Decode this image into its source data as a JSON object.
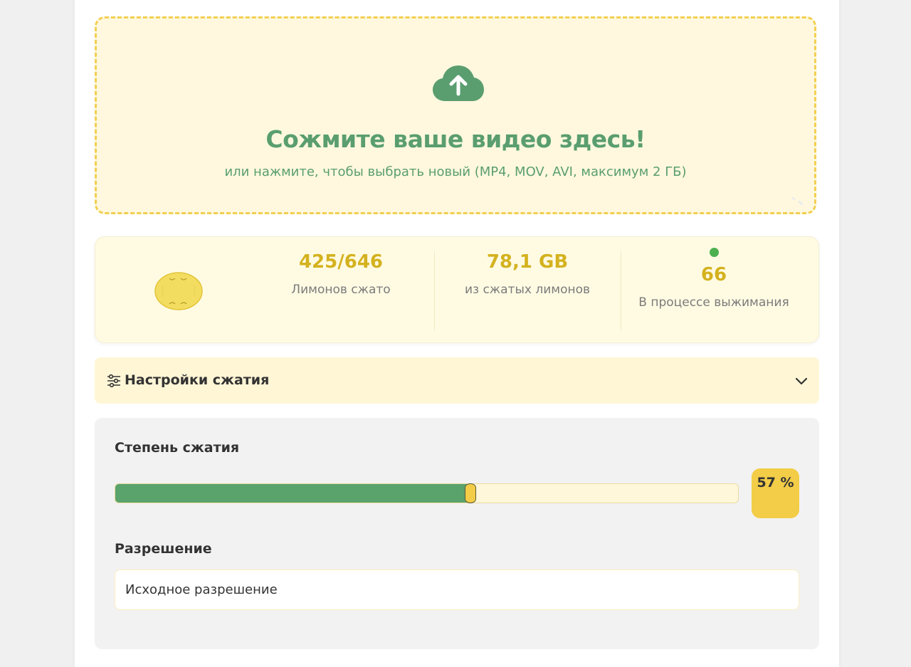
{
  "upload": {
    "icon": "cloud-upload-icon",
    "title": "Сожмите ваше видео здесь!",
    "subtitle": "или нажмите, чтобы выбрать новый (MP4, MOV, AVI, максимум 2 ГБ)"
  },
  "stats": {
    "compressed": {
      "value": "425/646",
      "label": "Лимонов сжато"
    },
    "size": {
      "value": "78,1 GB",
      "label": "из сжатых лимонов"
    },
    "in_progress": {
      "value": "66",
      "label": "В процессе выжимания",
      "status_color": "#4cb050"
    }
  },
  "settings": {
    "title": "Настройки сжатия",
    "compression_label": "Степень сжатия",
    "compression_value": 0.57,
    "compression_badge": "57 %",
    "resolution_label": "Разрешение",
    "resolution_value": "Исходное разрешение"
  },
  "colors": {
    "accent_green": "#5a9e6f",
    "lemon_yellow": "#f3cd47",
    "value_gold": "#d4b21f"
  }
}
